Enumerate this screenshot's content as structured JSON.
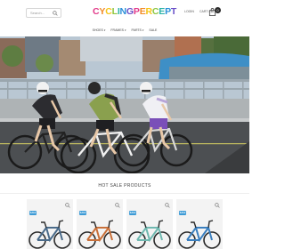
{
  "header": {
    "search_placeholder": "Search...",
    "logo_text": "CYCLINGPERCEPT",
    "logo_colors": [
      "#e23a8a",
      "#f28c28",
      "#f5c518",
      "#8cc63f",
      "#2bb3a8",
      "#2a8fd8",
      "#6a4fc8",
      "#e23a8a",
      "#f28c28",
      "#f5c518",
      "#8cc63f",
      "#2bb3a8",
      "#2a8fd8",
      "#6a4fc8"
    ],
    "login_label": "LOGIN",
    "cart_label": "CART / $0.00",
    "cart_count": "0"
  },
  "nav": {
    "items": [
      {
        "label": "SHOES",
        "has_dropdown": true
      },
      {
        "label": "FRAMES",
        "has_dropdown": true
      },
      {
        "label": "PARTS",
        "has_dropdown": true
      },
      {
        "label": "SALE",
        "has_dropdown": false
      }
    ]
  },
  "hero": {
    "icon": "cyclists-photo"
  },
  "section": {
    "title": "HOT SALE PRODUCTS"
  },
  "products": [
    {
      "badge": "SALE",
      "frame_color": "#4a6b8a",
      "badge_color": "#3d9bd6"
    },
    {
      "badge": "SALE",
      "frame_color": "#c8703a",
      "badge_color": "#3d9bd6"
    },
    {
      "badge": "SALE",
      "frame_color": "#6fb8b0",
      "badge_color": "#3d9bd6"
    },
    {
      "badge": "SALE",
      "frame_color": "#3a7fbf",
      "badge_color": "#3d9bd6"
    }
  ]
}
